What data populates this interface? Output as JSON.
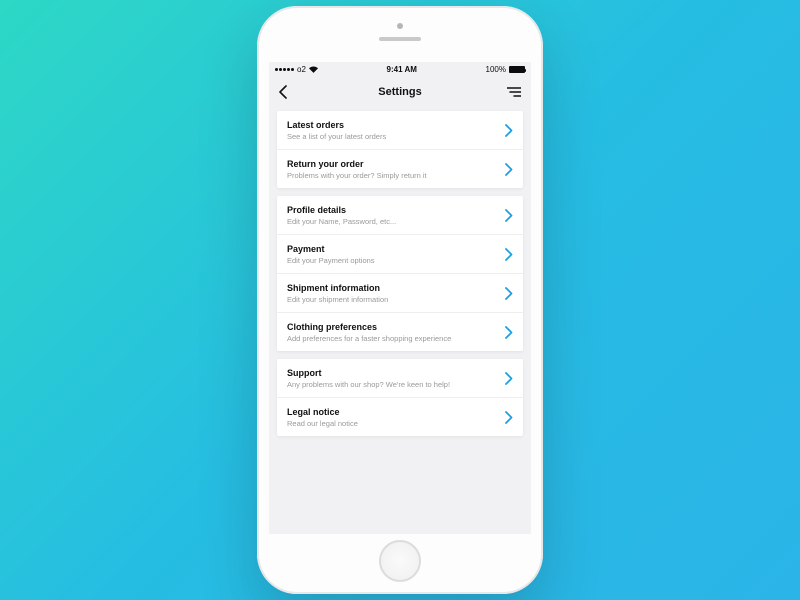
{
  "status_bar": {
    "carrier": "o2",
    "time": "9:41 AM",
    "battery_pct": "100%"
  },
  "nav": {
    "title": "Settings"
  },
  "colors": {
    "chevron": "#1e9fe0"
  },
  "groups": [
    {
      "items": [
        {
          "title": "Latest orders",
          "sub": "See a list of your latest orders"
        },
        {
          "title": "Return your order",
          "sub": "Problems with your order? Simply return it"
        }
      ]
    },
    {
      "items": [
        {
          "title": "Profile details",
          "sub": "Edit your Name, Password, etc..."
        },
        {
          "title": "Payment",
          "sub": "Edit your Payment options"
        },
        {
          "title": "Shipment information",
          "sub": "Edit your shipment information"
        },
        {
          "title": "Clothing preferences",
          "sub": "Add preferences for a faster shopping experience"
        }
      ]
    },
    {
      "items": [
        {
          "title": "Support",
          "sub": "Any problems with our shop? We're keen to help!"
        },
        {
          "title": "Legal notice",
          "sub": "Read our legal notice"
        }
      ]
    }
  ]
}
